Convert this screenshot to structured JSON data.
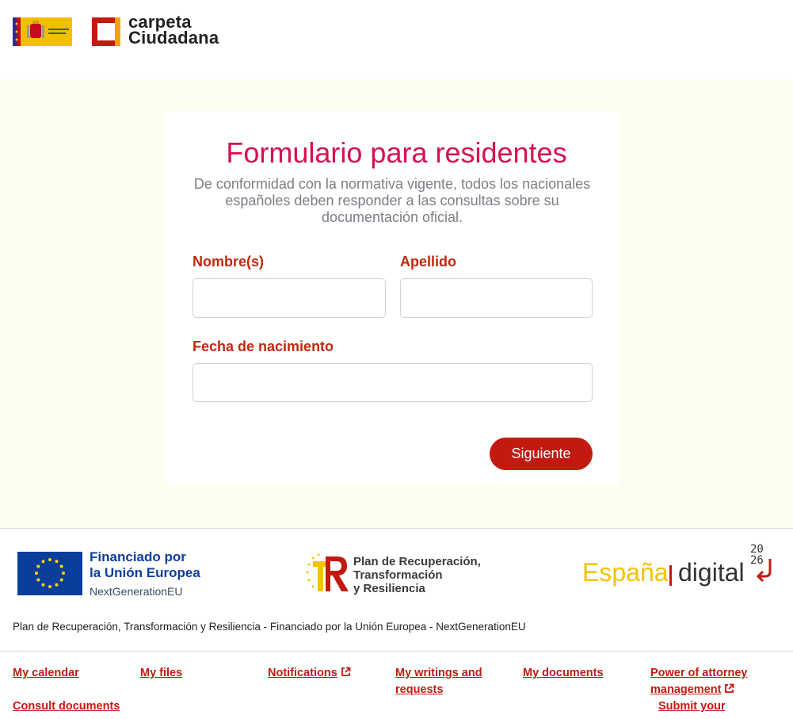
{
  "header": {
    "government_logo": "gobierno-de-espana-logo",
    "brand_line1": "carpeta",
    "brand_line2": "Ciudadana"
  },
  "form": {
    "title": "Formulario para residentes",
    "subtitle": "De conformidad con la normativa vigente, todos los nacionales españoles deben responder a las consultas sobre su documentación oficial.",
    "fields": {
      "first_name": {
        "label": "Nombre(s)",
        "value": ""
      },
      "last_name": {
        "label": "Apellido",
        "value": ""
      },
      "birth_date": {
        "label": "Fecha de nacimiento",
        "value": ""
      }
    },
    "next_button": "Siguiente"
  },
  "funding": {
    "eu_line1": "Financiado por",
    "eu_line2": "la Unión Europea",
    "eu_line3": "NextGenerationEU",
    "prtr_line1": "Plan de Recuperación,",
    "prtr_line2": "Transformación",
    "prtr_line3": "y Resiliencia",
    "espana": "España",
    "digital": "digital",
    "year_top": "20",
    "year_bottom": "26",
    "statement": "Plan de Recuperación, Transformación y Resiliencia - Financiado por la Unión Europea - NextGenerationEU"
  },
  "footer_links": [
    {
      "label": "My calendar",
      "external": false
    },
    {
      "label": "My files",
      "external": false
    },
    {
      "label": "Notifications",
      "external": true
    },
    {
      "label": "My writings and",
      "label2": "requests",
      "external": false
    },
    {
      "label": "My documents",
      "external": false
    },
    {
      "label": "Power of attorney",
      "label2": "management",
      "external": true
    },
    {
      "label": "Consult documents",
      "external": false
    },
    {
      "label": "Submit your",
      "external": false
    }
  ],
  "colors": {
    "title": "#d6114e",
    "label": "#c0280f",
    "button": "#c21a10",
    "link": "#c21a10",
    "eu_blue": "#0b3e9b",
    "espana_yellow": "#f5c200",
    "page_bg": "#fdfdf0"
  }
}
